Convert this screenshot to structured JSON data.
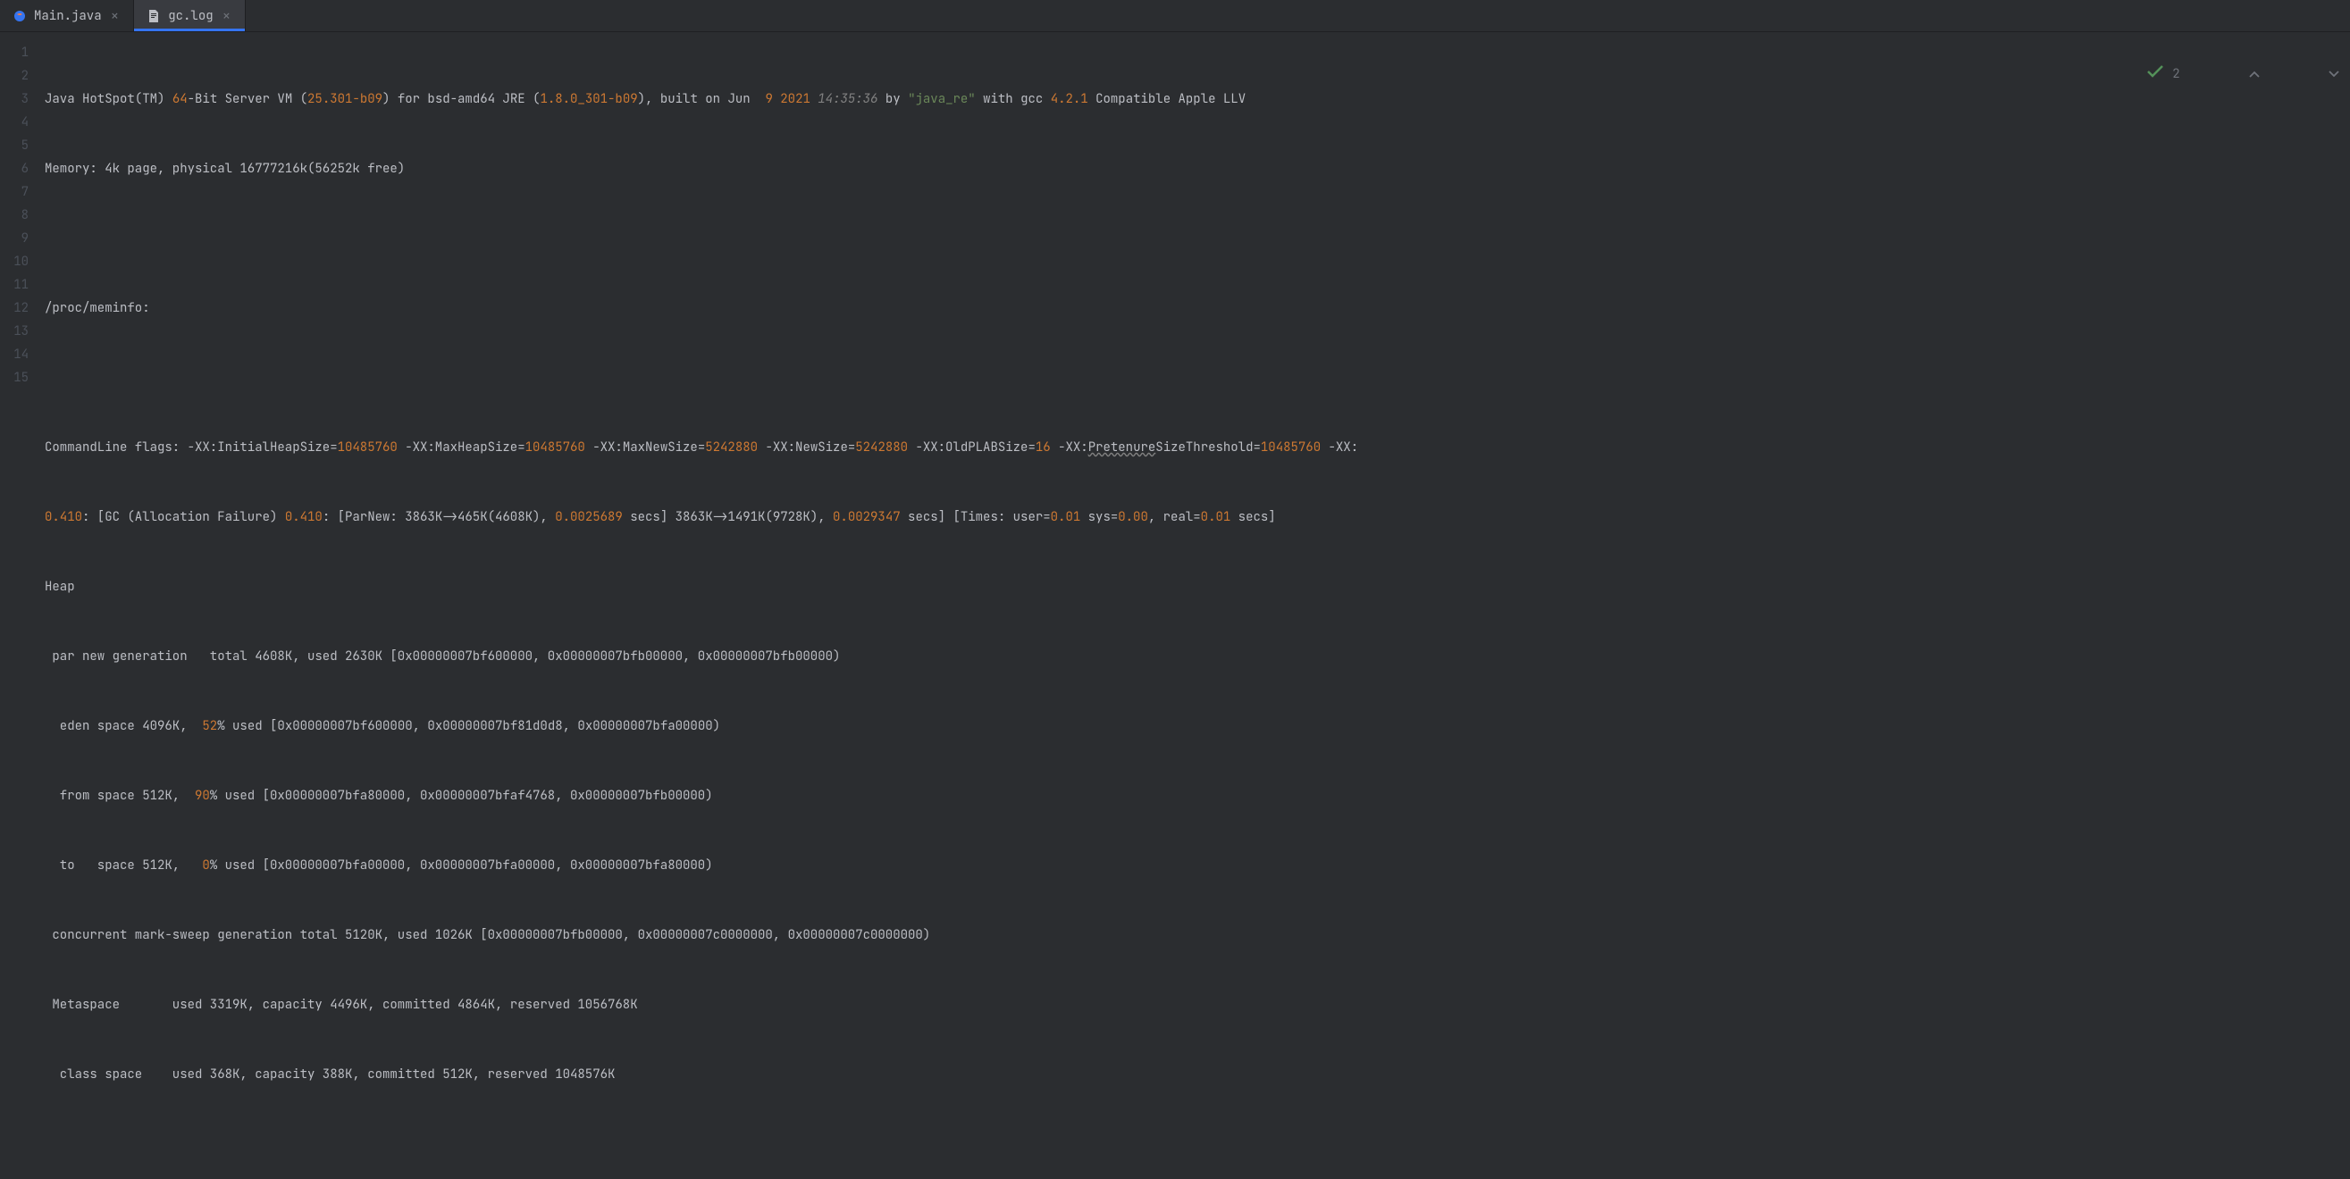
{
  "tabs": [
    {
      "label": "Main.java",
      "active": false,
      "icon": "java"
    },
    {
      "label": "gc.log",
      "active": true,
      "icon": "file"
    }
  ],
  "gutter_lines": [
    "1",
    "2",
    "3",
    "4",
    "5",
    "6",
    "7",
    "8",
    "9",
    "10",
    "11",
    "12",
    "13",
    "14",
    "15"
  ],
  "line1": {
    "p1": "Java HotSpot(TM) ",
    "n64": "64",
    "p2": "-Bit Server VM (",
    "ver": "25.301-b09",
    "p3": ") for bsd-amd64 JRE (",
    "jre": "1.8.0_301-b09",
    "p4": "), built on Jun  ",
    "day": "9",
    "p5": " ",
    "year": "2021",
    "p6": " ",
    "time": "14:35:36",
    "p7": " by ",
    "user": "\"java_re\"",
    "p8": " with gcc ",
    "gcc": "4.2.1",
    "p9": " Compatible Apple LLV"
  },
  "line2": "Memory: 4k page, physical 16777216k(56252k free)",
  "line4": "/proc/meminfo:",
  "line6": {
    "p1": "CommandLine flags: -XX:InitialHeapSize=",
    "v1": "10485760",
    "p2": " -XX:MaxHeapSize=",
    "v2": "10485760",
    "p3": " -XX:MaxNewSize=",
    "v3": "5242880",
    "p4": " -XX:NewSize=",
    "v4": "5242880",
    "p5": " -XX:OldPLABSize=",
    "v5": "16",
    "p6": " -XX:",
    "pret": "Pretenure",
    "p6b": "SizeThreshold=",
    "v6": "10485760",
    "p7": " -XX:"
  },
  "line7": {
    "t1": "0.410",
    "p1": ": [GC (Allocation Failure) ",
    "t2": "0.410",
    "p2": ": [ParNew: 3863K->465K(4608K), ",
    "s1": "0.0025689",
    "p3": " secs] 3863K->1491K(9728K), ",
    "s2": "0.0029347",
    "p4": " secs] [Times: user=",
    "u1": "0.01",
    "p5": " sys=",
    "u2": "0.00",
    "p6": ", real=",
    "u3": "0.01",
    "p7": " secs]"
  },
  "line8": "Heap",
  "line9": " par new generation   total 4608K, used 2630K [0x00000007bf600000, 0x00000007bfb00000, 0x00000007bfb00000)",
  "line10": {
    "p1": "  eden space 4096K,  ",
    "pct": "52",
    "p2": "% used [0x00000007bf600000, 0x00000007bf81d0d8, 0x00000007bfa00000)"
  },
  "line11": {
    "p1": "  from space 512K,  ",
    "pct": "90",
    "p2": "% used [0x00000007bfa80000, 0x00000007bfaf4768, 0x00000007bfb00000)"
  },
  "line12": {
    "p1": "  to   space 512K,   ",
    "pct": "0",
    "p2": "% used [0x00000007bfa00000, 0x00000007bfa00000, 0x00000007bfa80000)"
  },
  "line13": " concurrent mark-sweep generation total 5120K, used 1026K [0x00000007bfb00000, 0x00000007c0000000, 0x00000007c0000000)",
  "line14": " Metaspace       used 3319K, capacity 4496K, committed 4864K, reserved 1056768K",
  "line15": "  class space    used 368K, capacity 388K, committed 512K, reserved 1048576K",
  "widgets": {
    "count": "2"
  }
}
